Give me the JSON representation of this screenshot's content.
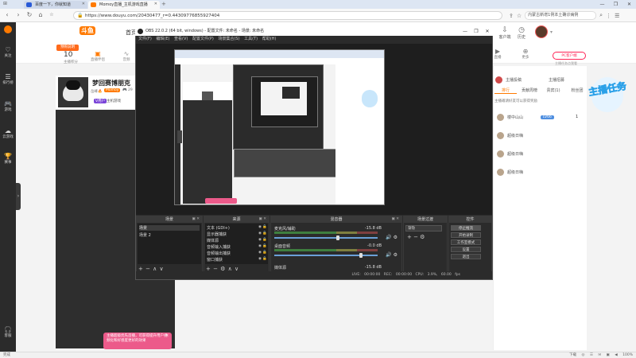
{
  "browser": {
    "tabs": [
      {
        "title": "百度一下，你就知道",
        "active": false,
        "favicon_color": "#2a5bd7"
      },
      {
        "title": "Momoy直播_主机游戏直播",
        "active": true,
        "favicon_color": "#ff7a00"
      }
    ],
    "url": "https://www.douyu.com/20430477_r=0.44309776855927404",
    "hot_search": "内蒙古新增1例本土确诊病例",
    "window_controls": [
      "—",
      "❐",
      "✕"
    ],
    "statusbar_left": "完成",
    "statusbar_right": "下载  ◎  ☰  ✉  ▣  ◀  100%"
  },
  "site": {
    "logo": "斗鱼",
    "nav_first": "首页",
    "left_nav": [
      {
        "label": "关注",
        "icon": "heart-icon"
      },
      {
        "label": "排行榜",
        "icon": "list-icon"
      },
      {
        "label": "游戏",
        "icon": "gamepad-icon"
      },
      {
        "label": "云游戏",
        "icon": "cloud-icon"
      },
      {
        "label": "赛事",
        "icon": "trophy-icon"
      },
      {
        "label": "客服",
        "icon": "headset-icon"
      }
    ],
    "header_badge": "预购说明",
    "header_level": "10",
    "header_level_caption": "主播积分",
    "header_minis": [
      {
        "label": "直播伴侣",
        "icon": "ticket-icon"
      },
      {
        "label": "音频",
        "icon": "audio-icon"
      }
    ],
    "header_right": [
      {
        "label": "客户端",
        "icon": "download-icon"
      },
      {
        "label": "历史",
        "icon": "history-icon"
      }
    ],
    "right_nav": [
      {
        "label": "直播",
        "icon": "play-icon"
      },
      {
        "label": "更多",
        "icon": "more-icon"
      }
    ],
    "streamer": {
      "name": "梦回赛博朋克",
      "tag1": "岳峰🔥",
      "tag2": "Momoy",
      "tag3": "🎮 29",
      "tag4": "V用户",
      "tag5": "主机游戏"
    },
    "right_panel": {
      "pc_button": "PC客户端",
      "pc_sub": "主播任务点我看",
      "row1_avatar_text": "A",
      "row1_label": "主播投稿",
      "row1_label2": "主播招募",
      "tabs": [
        "排行",
        "贡献周榜",
        "贵宾(1)",
        "粉丝团"
      ],
      "notice": "主播邀请好友可以获得奖励",
      "users": [
        {
          "name": "楼中山山",
          "level": "LV66",
          "count": "1"
        },
        {
          "name": "超级日嗨",
          "level": "",
          "count": ""
        },
        {
          "name": "超级日嗨",
          "level": "",
          "count": ""
        },
        {
          "name": "超级日嗨",
          "level": "",
          "count": ""
        }
      ],
      "renwu": "主播任务"
    },
    "pink_notice": "主播超级优先首播，可获得提升用户视频化和好感度更好的效果",
    "pink_close": "✕"
  },
  "obs": {
    "title": "OBS 22.0.2 (64 bit, windows) - 配置文件: 未命名 - 场景: 未命名",
    "window_controls": [
      "—",
      "❐",
      "✕"
    ],
    "menu": [
      "文件(F)",
      "编辑(E)",
      "查看(V)",
      "配置文件(P)",
      "场景集合(S)",
      "工具(T)",
      "帮助(H)"
    ],
    "docks": {
      "scenes": {
        "title": "场景",
        "items": [
          "场景",
          "场景 2"
        ],
        "footer": "+ − ∧ ∨"
      },
      "sources": {
        "title": "来源",
        "items": [
          "文本 (GDI+)",
          "显示器捕获",
          "媒体源",
          "音频输入捕获",
          "音频输出捕获",
          "窗口捕获"
        ],
        "footer": "+ − ⚙ ∧ ∨"
      },
      "mixer": {
        "title": "混音器",
        "channels": [
          {
            "name": "麦克风/辅助",
            "db": "-15.8 dB",
            "level": 0.62
          },
          {
            "name": "桌面音频",
            "db": "-0.0 dB",
            "level": 0.85
          },
          {
            "name": "媒体源",
            "db": "-15.8 dB",
            "level": 0.4
          }
        ]
      },
      "transitions": {
        "title": "场景过渡",
        "selected": "渐隐",
        "footer": "+ − ⚙"
      },
      "controls": {
        "title": "控件",
        "buttons": [
          "停止推流",
          "开始录制",
          "工作室模式",
          "设置",
          "退出"
        ]
      }
    },
    "status": "LIVE: 00:00:00   REC: 00:00:00   CPU: 3.9%, 60.00 fps",
    "dock_close_glyph": "▣ ✕"
  },
  "colors": {
    "accent": "#ff7a00",
    "pink": "#ec5a8a",
    "obs_bg": "#2b2b2b"
  }
}
